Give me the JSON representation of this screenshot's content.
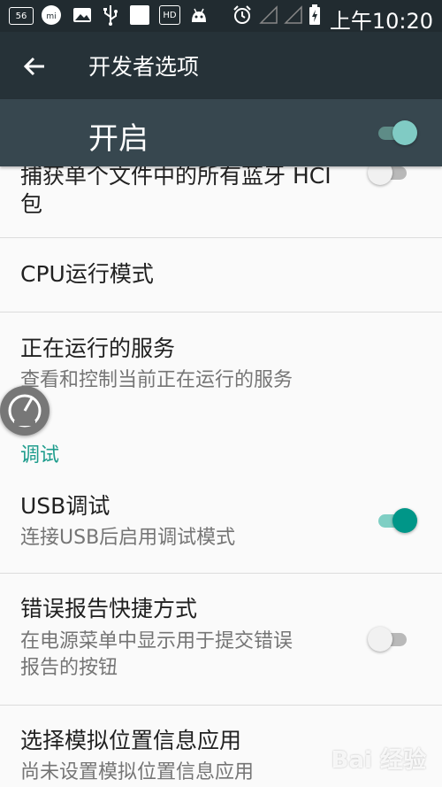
{
  "status_bar": {
    "badge": "56",
    "mi_label": "mi",
    "hd_label": "HD",
    "time": "上午10:20"
  },
  "toolbar": {
    "title": "开发者选项",
    "back_icon": "arrow-back-icon"
  },
  "master": {
    "label": "开启",
    "enabled": true
  },
  "items": {
    "hci": {
      "title": "捕获单个文件中的所有蓝牙 HCI",
      "title2": "包",
      "enabled": false
    },
    "cpu": {
      "title": "CPU运行模式"
    },
    "running": {
      "title": "正在运行的服务",
      "summary": "查看和控制当前正在运行的服务"
    },
    "debug_category": "调试",
    "usb": {
      "title": "USB调试",
      "summary": "连接USB后启用调试模式",
      "enabled": true
    },
    "bugreport": {
      "title": "错误报告快捷方式",
      "summary": "在电源菜单中显示用于提交错误",
      "summary2": "报告的按钮",
      "enabled": false
    },
    "mock": {
      "title": "选择模拟位置信息应用",
      "summary": "尚未设置模拟位置信息应用"
    }
  },
  "watermark": "Bai 经验",
  "colors": {
    "accent": "#009688",
    "toolbar": "#263238",
    "masterbar": "#37474f",
    "category": "#1d9c8c"
  }
}
